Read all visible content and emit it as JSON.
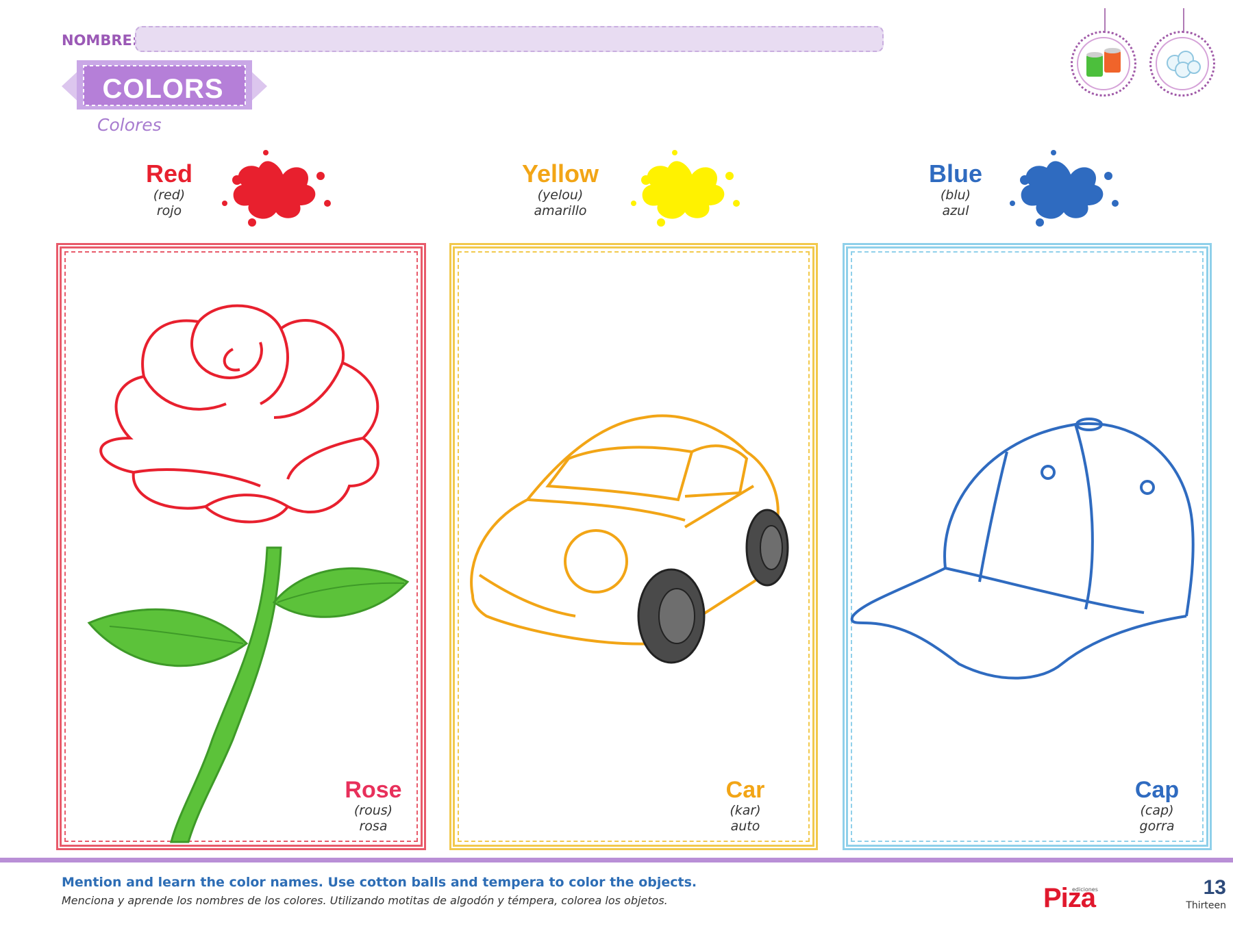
{
  "header": {
    "name_label": "NOMBRE:",
    "title": "COLORS",
    "subtitle": "Colores",
    "badges": [
      {
        "icon": "tempera-paint-icon"
      },
      {
        "icon": "cotton-balls-icon"
      }
    ]
  },
  "colors": [
    {
      "name": "Red",
      "pronunciation": "(red)",
      "spanish": "rojo",
      "hex": "#e8202e"
    },
    {
      "name": "Yellow",
      "pronunciation": "(yelou)",
      "spanish": "amarillo",
      "hex": "#fff200"
    },
    {
      "name": "Blue",
      "pronunciation": "(blu)",
      "spanish": "azul",
      "hex": "#2f6bc0"
    }
  ],
  "objects": [
    {
      "name": "Rose",
      "pronunciation": "(rous)",
      "spanish": "rosa",
      "hex": "#e8305b",
      "frame": "#e85a6a",
      "icon": "rose-icon"
    },
    {
      "name": "Car",
      "pronunciation": "(kar)",
      "spanish": "auto",
      "hex": "#f2a516",
      "frame": "#f2c94c",
      "icon": "car-icon"
    },
    {
      "name": "Cap",
      "pronunciation": "(cap)",
      "spanish": "gorra",
      "hex": "#2f6bc0",
      "frame": "#8fd0ea",
      "icon": "cap-icon"
    }
  ],
  "footer": {
    "instruction_en": "Mention and learn the color names. Use cotton balls and tempera to color the objects.",
    "instruction_es": "Menciona y aprende los nombres de los colores. Utilizando motitas de algodón y témpera, colorea los objetos.",
    "publisher_small": "ediciones",
    "publisher": "Piza",
    "page_number": "13",
    "page_word": "Thirteen"
  }
}
